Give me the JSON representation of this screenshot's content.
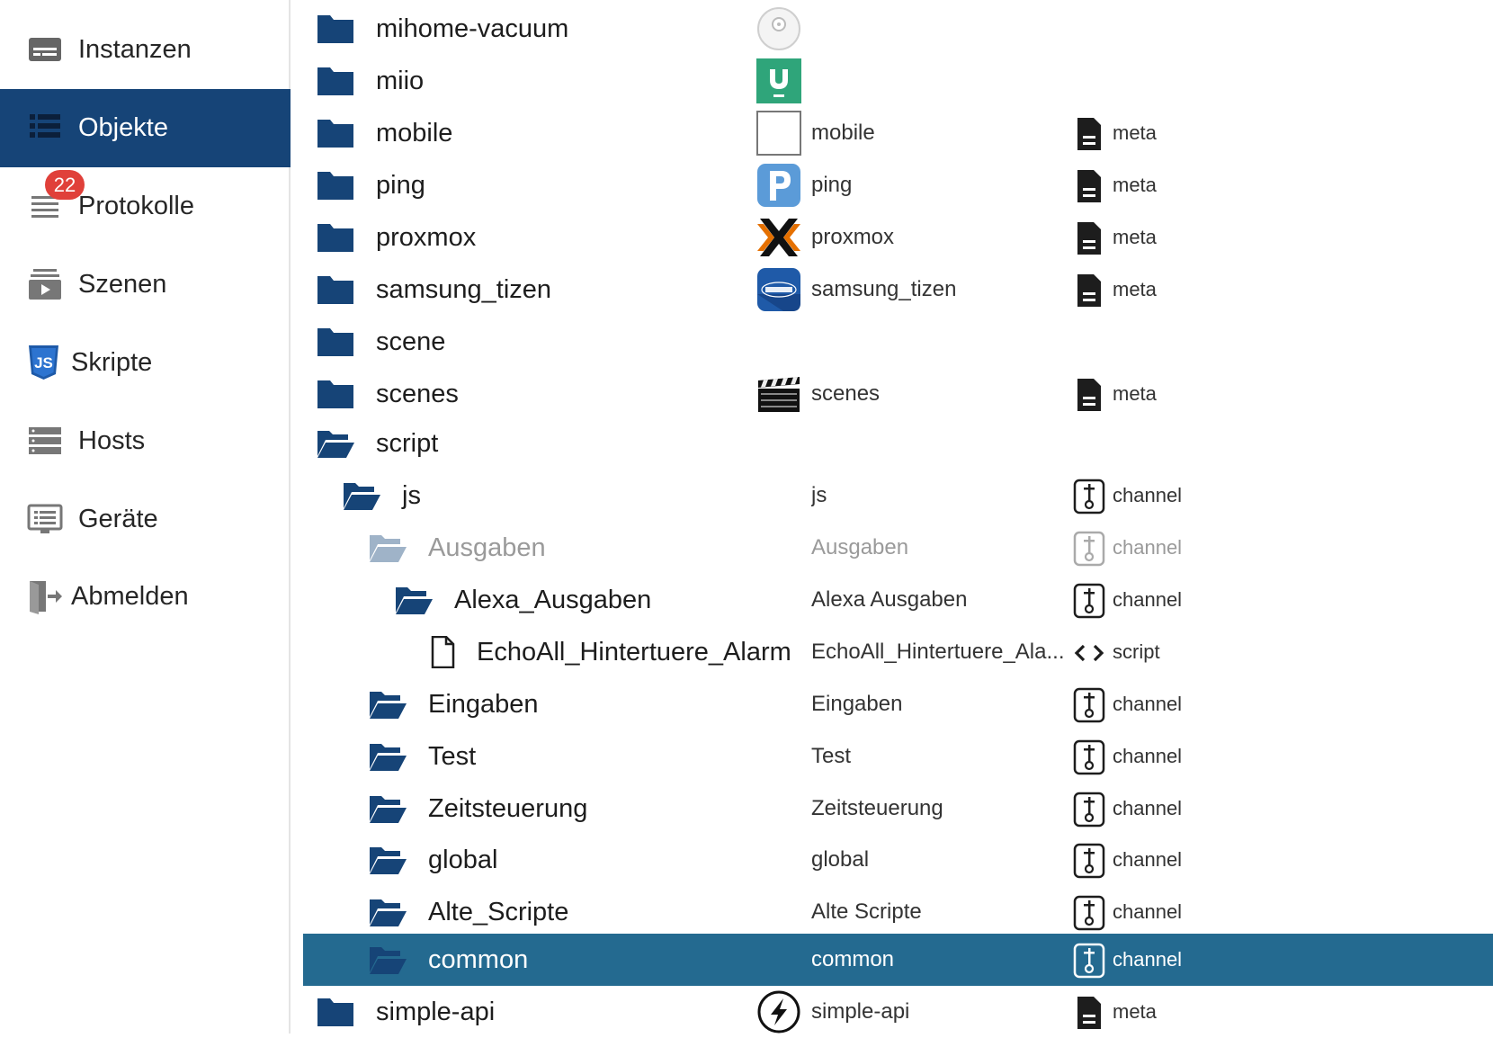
{
  "sidebar": {
    "items": [
      {
        "label": "Instanzen",
        "icon": "instances-icon"
      },
      {
        "label": "Objekte",
        "icon": "objects-icon",
        "active": true
      },
      {
        "label": "Protokolle",
        "icon": "logs-icon",
        "badge": "22"
      },
      {
        "label": "Szenen",
        "icon": "scenes-icon"
      },
      {
        "label": "Skripte",
        "icon": "js-icon"
      },
      {
        "label": "Hosts",
        "icon": "hosts-icon"
      },
      {
        "label": "Geräte",
        "icon": "devices-icon"
      },
      {
        "label": "Abmelden",
        "icon": "logout-icon"
      }
    ]
  },
  "colors": {
    "accent": "#164477",
    "selected_row": "#246a90",
    "folder": "#164477",
    "badge": "#e0403a"
  },
  "tree": {
    "rows": [
      {
        "name": "mihome-vacuum",
        "level": 0,
        "folder": "closed",
        "icon": "vacuum-icon",
        "title": "",
        "type": ""
      },
      {
        "name": "miio",
        "level": 0,
        "folder": "closed",
        "icon": "miio-icon",
        "title": "",
        "type": ""
      },
      {
        "name": "mobile",
        "level": 0,
        "folder": "closed",
        "icon": "mobile-icon",
        "title": "mobile",
        "type": "meta"
      },
      {
        "name": "ping",
        "level": 0,
        "folder": "closed",
        "icon": "ping-icon",
        "title": "ping",
        "type": "meta"
      },
      {
        "name": "proxmox",
        "level": 0,
        "folder": "closed",
        "icon": "proxmox-icon",
        "title": "proxmox",
        "type": "meta"
      },
      {
        "name": "samsung_tizen",
        "level": 0,
        "folder": "closed",
        "icon": "samsung-icon",
        "title": "samsung_tizen",
        "type": "meta"
      },
      {
        "name": "scene",
        "level": 0,
        "folder": "closed",
        "icon": "",
        "title": "",
        "type": ""
      },
      {
        "name": "scenes",
        "level": 0,
        "folder": "closed",
        "icon": "clapper-icon",
        "title": "scenes",
        "type": "meta"
      },
      {
        "name": "script",
        "level": 0,
        "folder": "open",
        "icon": "",
        "title": "",
        "type": ""
      },
      {
        "name": "js",
        "level": 1,
        "folder": "open",
        "icon": "",
        "title": "js",
        "type": "channel"
      },
      {
        "name": "Ausgaben",
        "level": 2,
        "folder": "open",
        "icon": "",
        "title": "Ausgaben",
        "type": "channel",
        "dim": true
      },
      {
        "name": "Alexa_Ausgaben",
        "level": 3,
        "folder": "open",
        "icon": "",
        "title": "Alexa Ausgaben",
        "type": "channel"
      },
      {
        "name": "EchoAll_Hintertuere_Alarm",
        "level": 4,
        "folder": "file",
        "icon": "",
        "title": "EchoAll_Hintertuere_Ala...",
        "type": "script"
      },
      {
        "name": "Eingaben",
        "level": 2,
        "folder": "open",
        "icon": "",
        "title": "Eingaben",
        "type": "channel"
      },
      {
        "name": "Test",
        "level": 2,
        "folder": "open",
        "icon": "",
        "title": "Test",
        "type": "channel"
      },
      {
        "name": "Zeitsteuerung",
        "level": 2,
        "folder": "open",
        "icon": "",
        "title": "Zeitsteuerung",
        "type": "channel"
      },
      {
        "name": "global",
        "level": 2,
        "folder": "open",
        "icon": "",
        "title": "global",
        "type": "channel"
      },
      {
        "name": "Alte_Scripte",
        "level": 2,
        "folder": "open",
        "icon": "",
        "title": "Alte Scripte",
        "type": "channel"
      },
      {
        "name": "common",
        "level": 2,
        "folder": "open",
        "icon": "",
        "title": "common",
        "type": "channel",
        "selected": true
      },
      {
        "name": "simple-api",
        "level": 0,
        "folder": "closed",
        "icon": "simple-api-icon",
        "title": "simple-api",
        "type": "meta"
      }
    ]
  }
}
